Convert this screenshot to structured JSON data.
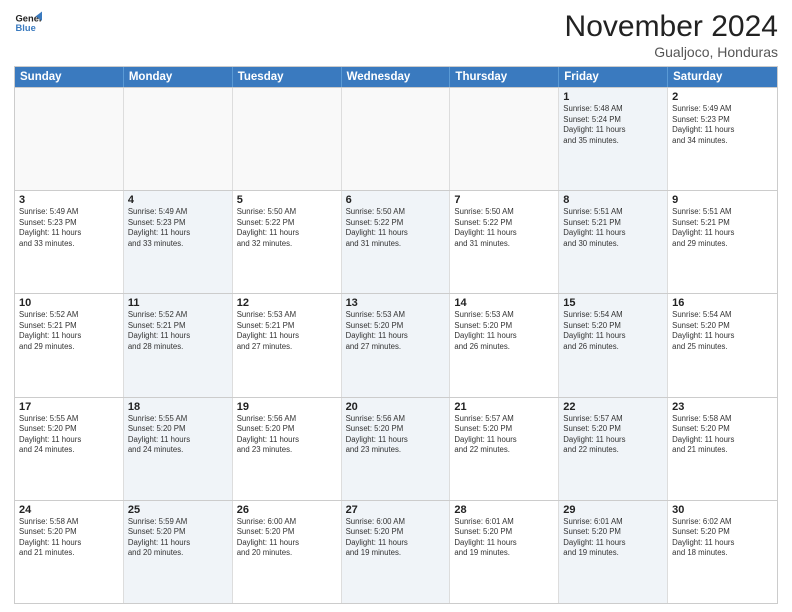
{
  "header": {
    "logo_line1": "General",
    "logo_line2": "Blue",
    "month_title": "November 2024",
    "subtitle": "Gualjoco, Honduras"
  },
  "weekdays": [
    "Sunday",
    "Monday",
    "Tuesday",
    "Wednesday",
    "Thursday",
    "Friday",
    "Saturday"
  ],
  "weeks": [
    [
      {
        "day": "",
        "info": ""
      },
      {
        "day": "",
        "info": ""
      },
      {
        "day": "",
        "info": ""
      },
      {
        "day": "",
        "info": ""
      },
      {
        "day": "",
        "info": ""
      },
      {
        "day": "1",
        "info": "Sunrise: 5:48 AM\nSunset: 5:24 PM\nDaylight: 11 hours\nand 35 minutes."
      },
      {
        "day": "2",
        "info": "Sunrise: 5:49 AM\nSunset: 5:23 PM\nDaylight: 11 hours\nand 34 minutes."
      }
    ],
    [
      {
        "day": "3",
        "info": "Sunrise: 5:49 AM\nSunset: 5:23 PM\nDaylight: 11 hours\nand 33 minutes."
      },
      {
        "day": "4",
        "info": "Sunrise: 5:49 AM\nSunset: 5:23 PM\nDaylight: 11 hours\nand 33 minutes."
      },
      {
        "day": "5",
        "info": "Sunrise: 5:50 AM\nSunset: 5:22 PM\nDaylight: 11 hours\nand 32 minutes."
      },
      {
        "day": "6",
        "info": "Sunrise: 5:50 AM\nSunset: 5:22 PM\nDaylight: 11 hours\nand 31 minutes."
      },
      {
        "day": "7",
        "info": "Sunrise: 5:50 AM\nSunset: 5:22 PM\nDaylight: 11 hours\nand 31 minutes."
      },
      {
        "day": "8",
        "info": "Sunrise: 5:51 AM\nSunset: 5:21 PM\nDaylight: 11 hours\nand 30 minutes."
      },
      {
        "day": "9",
        "info": "Sunrise: 5:51 AM\nSunset: 5:21 PM\nDaylight: 11 hours\nand 29 minutes."
      }
    ],
    [
      {
        "day": "10",
        "info": "Sunrise: 5:52 AM\nSunset: 5:21 PM\nDaylight: 11 hours\nand 29 minutes."
      },
      {
        "day": "11",
        "info": "Sunrise: 5:52 AM\nSunset: 5:21 PM\nDaylight: 11 hours\nand 28 minutes."
      },
      {
        "day": "12",
        "info": "Sunrise: 5:53 AM\nSunset: 5:21 PM\nDaylight: 11 hours\nand 27 minutes."
      },
      {
        "day": "13",
        "info": "Sunrise: 5:53 AM\nSunset: 5:20 PM\nDaylight: 11 hours\nand 27 minutes."
      },
      {
        "day": "14",
        "info": "Sunrise: 5:53 AM\nSunset: 5:20 PM\nDaylight: 11 hours\nand 26 minutes."
      },
      {
        "day": "15",
        "info": "Sunrise: 5:54 AM\nSunset: 5:20 PM\nDaylight: 11 hours\nand 26 minutes."
      },
      {
        "day": "16",
        "info": "Sunrise: 5:54 AM\nSunset: 5:20 PM\nDaylight: 11 hours\nand 25 minutes."
      }
    ],
    [
      {
        "day": "17",
        "info": "Sunrise: 5:55 AM\nSunset: 5:20 PM\nDaylight: 11 hours\nand 24 minutes."
      },
      {
        "day": "18",
        "info": "Sunrise: 5:55 AM\nSunset: 5:20 PM\nDaylight: 11 hours\nand 24 minutes."
      },
      {
        "day": "19",
        "info": "Sunrise: 5:56 AM\nSunset: 5:20 PM\nDaylight: 11 hours\nand 23 minutes."
      },
      {
        "day": "20",
        "info": "Sunrise: 5:56 AM\nSunset: 5:20 PM\nDaylight: 11 hours\nand 23 minutes."
      },
      {
        "day": "21",
        "info": "Sunrise: 5:57 AM\nSunset: 5:20 PM\nDaylight: 11 hours\nand 22 minutes."
      },
      {
        "day": "22",
        "info": "Sunrise: 5:57 AM\nSunset: 5:20 PM\nDaylight: 11 hours\nand 22 minutes."
      },
      {
        "day": "23",
        "info": "Sunrise: 5:58 AM\nSunset: 5:20 PM\nDaylight: 11 hours\nand 21 minutes."
      }
    ],
    [
      {
        "day": "24",
        "info": "Sunrise: 5:58 AM\nSunset: 5:20 PM\nDaylight: 11 hours\nand 21 minutes."
      },
      {
        "day": "25",
        "info": "Sunrise: 5:59 AM\nSunset: 5:20 PM\nDaylight: 11 hours\nand 20 minutes."
      },
      {
        "day": "26",
        "info": "Sunrise: 6:00 AM\nSunset: 5:20 PM\nDaylight: 11 hours\nand 20 minutes."
      },
      {
        "day": "27",
        "info": "Sunrise: 6:00 AM\nSunset: 5:20 PM\nDaylight: 11 hours\nand 19 minutes."
      },
      {
        "day": "28",
        "info": "Sunrise: 6:01 AM\nSunset: 5:20 PM\nDaylight: 11 hours\nand 19 minutes."
      },
      {
        "day": "29",
        "info": "Sunrise: 6:01 AM\nSunset: 5:20 PM\nDaylight: 11 hours\nand 19 minutes."
      },
      {
        "day": "30",
        "info": "Sunrise: 6:02 AM\nSunset: 5:20 PM\nDaylight: 11 hours\nand 18 minutes."
      }
    ]
  ]
}
